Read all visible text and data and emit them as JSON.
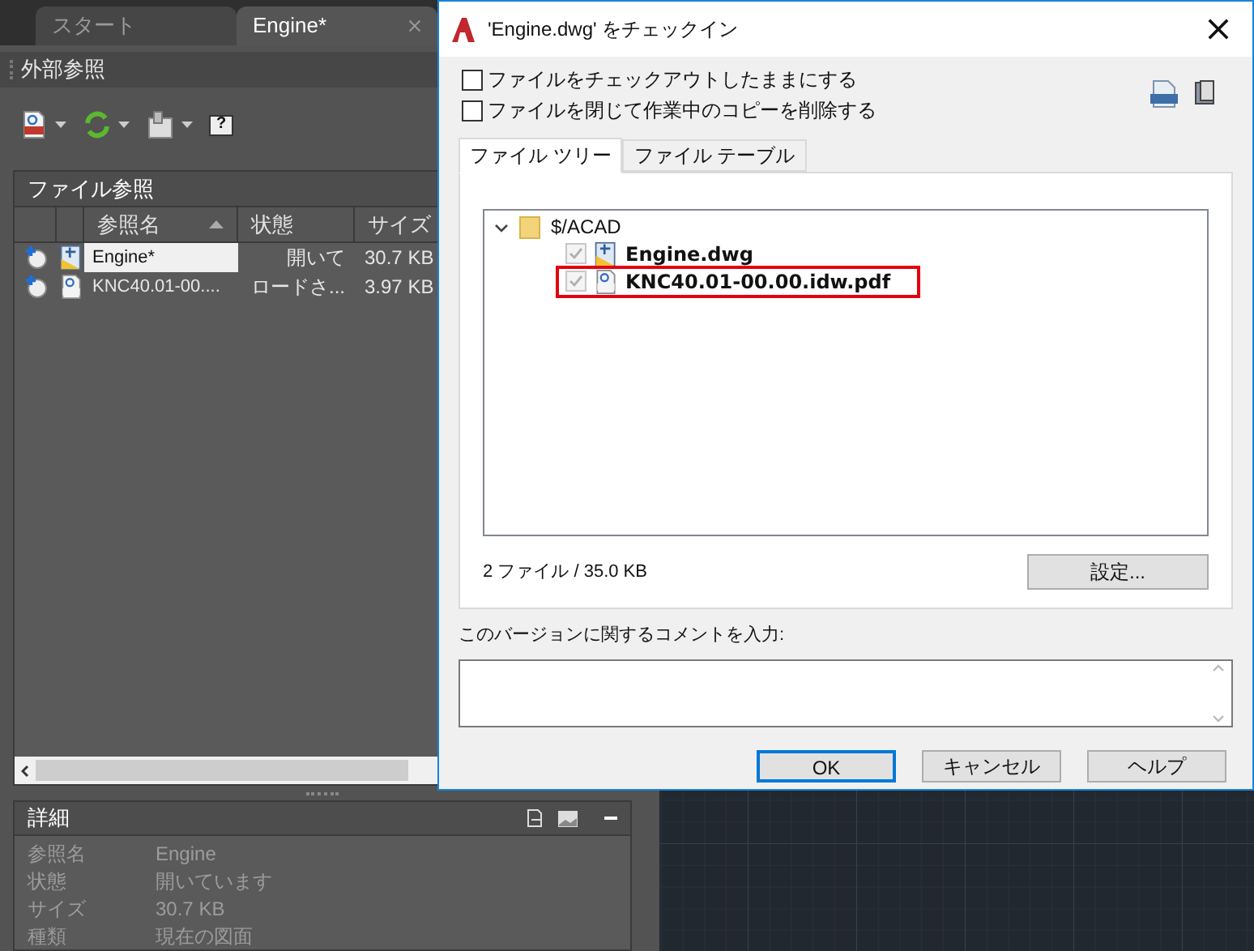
{
  "editor_tabs": [
    {
      "label": "スタート",
      "selected": false
    },
    {
      "label": "Engine*",
      "selected": true
    }
  ],
  "palette": {
    "title": "外部参照",
    "help_glyph": "?",
    "file_references": {
      "title": "ファイル参照",
      "columns": [
        {
          "label": "参照名",
          "sorted": true
        },
        {
          "label": "状態",
          "sorted": false
        },
        {
          "label": "サイズ",
          "sorted": false
        }
      ],
      "rows": [
        {
          "name": "Engine*",
          "status": "開いて",
          "size": "30.7 KB",
          "kind": "dwg",
          "selected": true
        },
        {
          "name": "KNC40.01-00....",
          "status": "ロードさ...",
          "size": "3.97 KB",
          "kind": "pdf",
          "selected": false
        }
      ]
    },
    "details": {
      "title": "詳細",
      "rows": [
        {
          "label": "参照名",
          "value": "Engine"
        },
        {
          "label": "状態",
          "value": "開いています"
        },
        {
          "label": "サイズ",
          "value": "30.7 KB"
        },
        {
          "label": "種類",
          "value": "現在の図面"
        }
      ]
    }
  },
  "dialog": {
    "title": "'Engine.dwg' をチェックイン",
    "options": [
      {
        "label": "ファイルをチェックアウトしたままにする",
        "checked": false
      },
      {
        "label": "ファイルを閉じて作業中のコピーを削除する",
        "checked": false
      }
    ],
    "tabs": [
      {
        "label": "ファイル ツリー",
        "selected": true
      },
      {
        "label": "ファイル テーブル",
        "selected": false
      }
    ],
    "tree": [
      {
        "label": "$/ACAD",
        "kind": "folder",
        "expanded": true,
        "children": [
          {
            "label": "Engine.dwg",
            "kind": "dwg",
            "checked": true,
            "highlighted": false
          },
          {
            "label": "KNC40.01-00.00.idw.pdf",
            "kind": "pdf",
            "checked": true,
            "highlighted": true
          }
        ]
      }
    ],
    "summary": "2 ファイル / 35.0 KB",
    "settings_button": "設定...",
    "comment_label": "このバージョンに関するコメントを入力:",
    "buttons": [
      {
        "label": "OK",
        "focused": true
      },
      {
        "label": "キャンセル",
        "focused": false
      },
      {
        "label": "ヘルプ",
        "focused": false
      }
    ]
  }
}
